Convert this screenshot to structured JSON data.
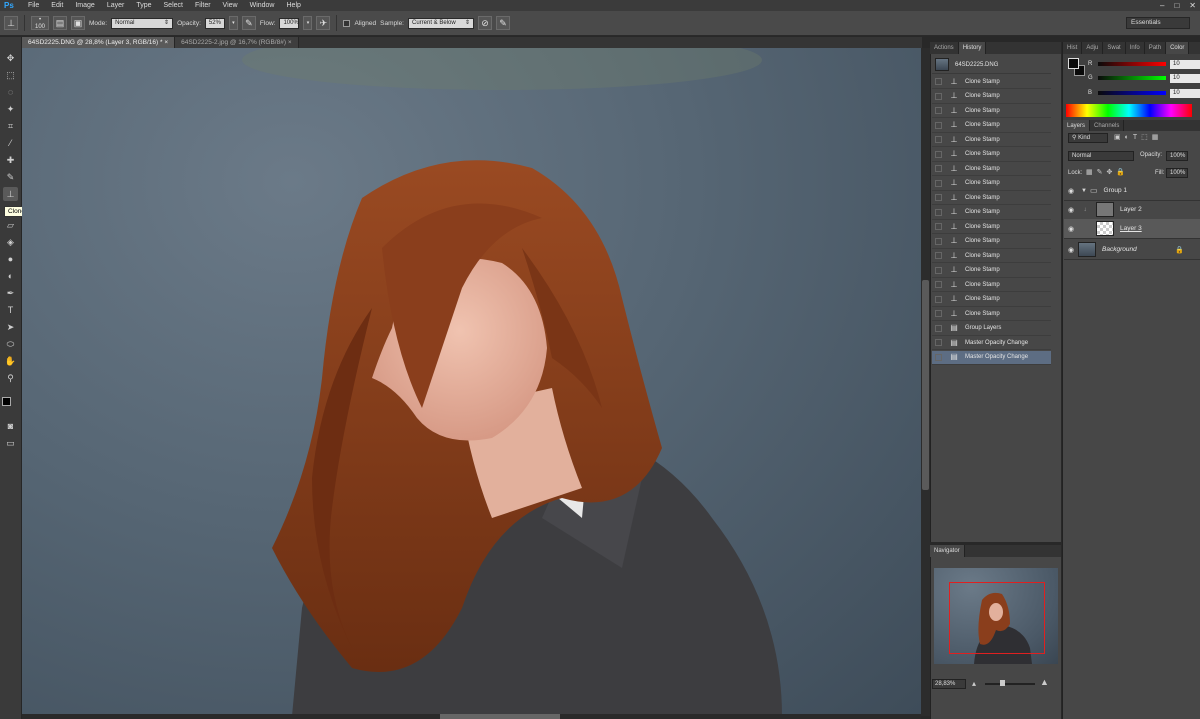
{
  "menubar": {
    "logo": "Ps",
    "items": [
      "File",
      "Edit",
      "Image",
      "Layer",
      "Type",
      "Select",
      "Filter",
      "View",
      "Window",
      "Help"
    ],
    "controls": [
      "–",
      "□",
      "✕"
    ]
  },
  "options": {
    "brush_size": "100",
    "mode_label": "Mode:",
    "mode_value": "Normal",
    "opacity_label": "Opacity:",
    "opacity_value": "52%",
    "flow_label": "Flow:",
    "flow_value": "100%",
    "aligned_label": "Aligned",
    "sample_label": "Sample:",
    "sample_value": "Current & Below",
    "workspace": "Essentials"
  },
  "doc_tabs": [
    {
      "label": "64SD2225.DNG @ 28,8% (Layer 3, RGB/16) *",
      "close": "×"
    },
    {
      "label": "64SD2225-2.jpg @ 16,7% (RGB/8#)",
      "close": "×"
    }
  ],
  "tooltip": "Clone Stamp Tool (S)",
  "history": {
    "tabs": [
      "Actions",
      "History"
    ],
    "snapshot": "64SD2225.DNG",
    "items": [
      "Clone Stamp",
      "Clone Stamp",
      "Clone Stamp",
      "Clone Stamp",
      "Clone Stamp",
      "Clone Stamp",
      "Clone Stamp",
      "Clone Stamp",
      "Clone Stamp",
      "Clone Stamp",
      "Clone Stamp",
      "Clone Stamp",
      "Clone Stamp",
      "Clone Stamp",
      "Clone Stamp",
      "Clone Stamp",
      "Clone Stamp",
      "Group Layers",
      "Master Opacity Change",
      "Master Opacity Change"
    ]
  },
  "navigator": {
    "tab": "Navigator",
    "zoom": "28,83%"
  },
  "color": {
    "tabs": [
      "Hist",
      "Adju",
      "Swat",
      "Info",
      "Path",
      "Color"
    ],
    "r_label": "R",
    "g_label": "G",
    "b_label": "B",
    "r_value": "10",
    "g_value": "10",
    "b_value": "10"
  },
  "layers": {
    "tabs": [
      "Layers",
      "Channels"
    ],
    "kind": "Kind",
    "blend": "Normal",
    "opacity_label": "Opacity:",
    "opacity_value": "100%",
    "lock_label": "Lock:",
    "fill_label": "Fill:",
    "fill_value": "100%",
    "items": [
      "Group 1",
      "Layer 2",
      "Layer 3",
      "Background"
    ]
  },
  "colors": {
    "accent": "#31a8ff",
    "selection": "#5d6d83",
    "nav_box": "#e02020"
  }
}
